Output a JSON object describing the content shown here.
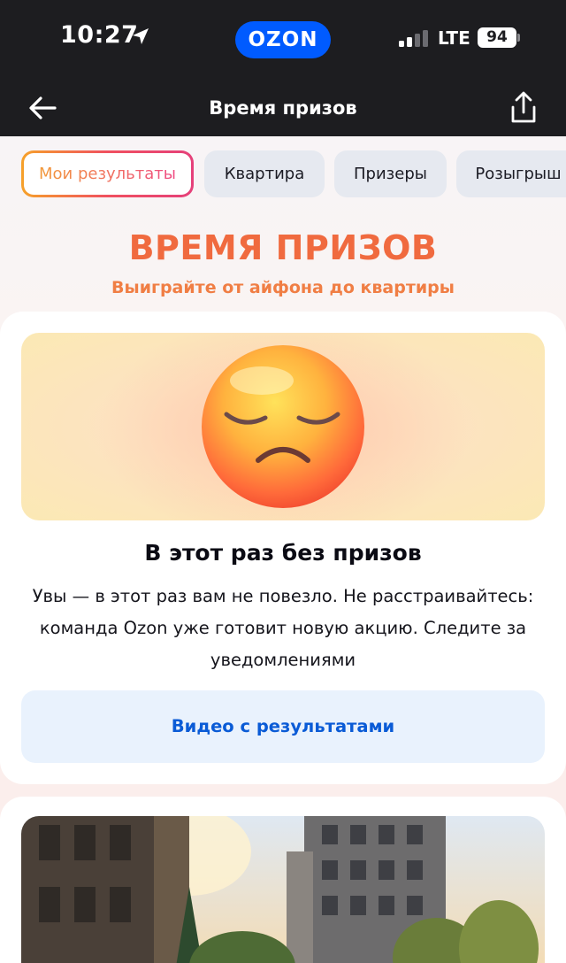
{
  "status_bar": {
    "time": "10:27",
    "carrier_logo": "OZON",
    "network": "LTE",
    "battery": "94",
    "icons": [
      "location-arrow-icon",
      "signal-bars-icon",
      "battery-icon"
    ]
  },
  "nav": {
    "title": "Время призов",
    "back_icon": "arrow-left-icon",
    "share_icon": "share-icon"
  },
  "tabs": [
    {
      "label": "Мои результаты",
      "active": true
    },
    {
      "label": "Квартира",
      "active": false
    },
    {
      "label": "Призеры",
      "active": false
    },
    {
      "label": "Розыгрыш",
      "active": false
    }
  ],
  "hero": {
    "title": "ВРЕМЯ ПРИЗОВ",
    "subtitle": "Выиграйте от айфона до квартиры"
  },
  "result": {
    "image": "sad-face-emoji",
    "heading": "В этот раз без призов",
    "text": "Увы — в этот раз вам не повезло. Не расстраивайтесь: команда Ozon уже готовит новую акцию. Следите за уведомлениями",
    "button": "Видео с результатами"
  },
  "prize_card": {
    "image": "apartment-building-photo"
  },
  "colors": {
    "ozon_blue": "#005bff",
    "title_orange": "#f06a3f",
    "link_blue": "#0a5bd6",
    "dark_bar": "#1d1d20"
  }
}
